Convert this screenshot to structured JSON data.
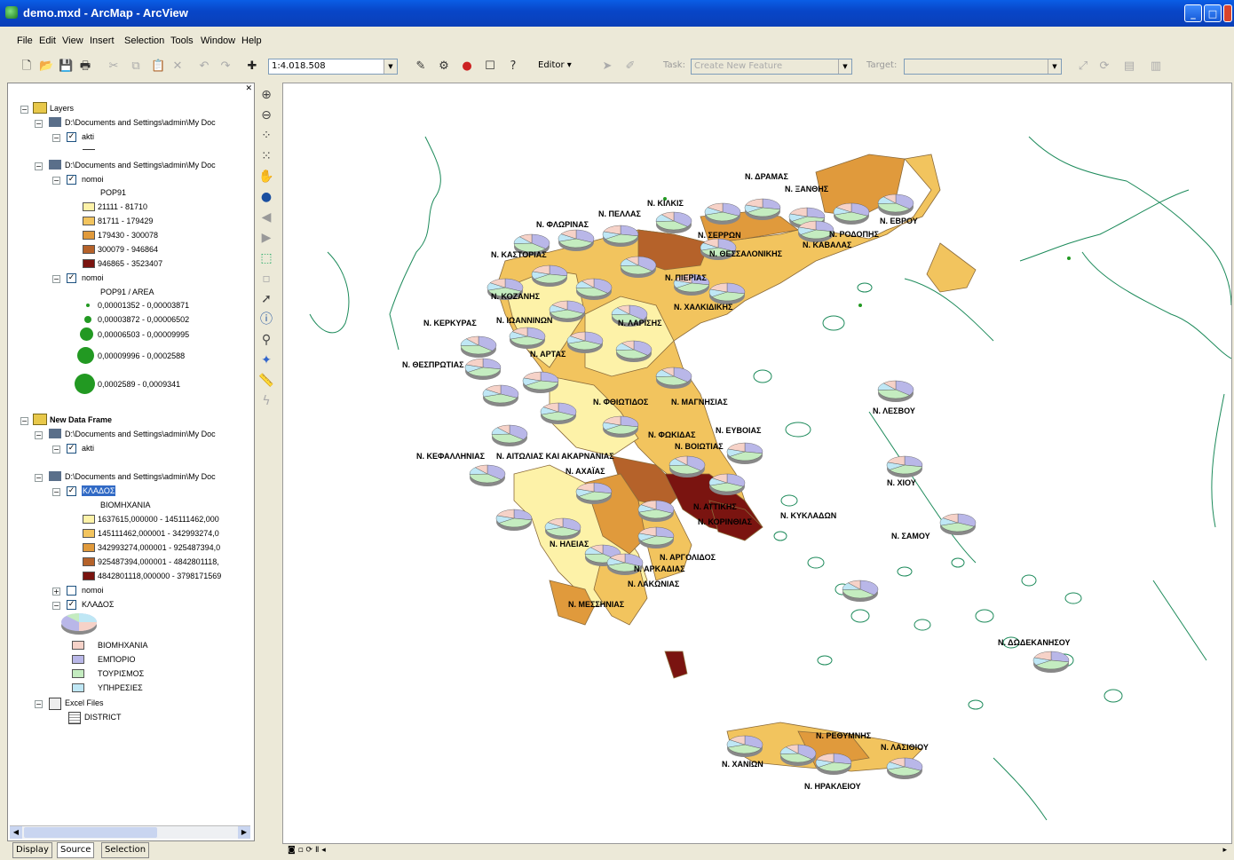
{
  "window": {
    "title": "demo.mxd - ArcMap - ArcView"
  },
  "menu": [
    "File",
    "Edit",
    "View",
    "Insert",
    "Selection",
    "Tools",
    "Window",
    "Help"
  ],
  "toolbar": {
    "scale": "1:4.018.508",
    "editor_label": "Editor",
    "task_label": "Task:",
    "task_value": "Create New Feature",
    "target_label": "Target:"
  },
  "toc": {
    "frame1": "Layers",
    "path": "D:\\Documents and Settings\\admin\\My Doc",
    "layer_akti": "akti",
    "layer_nomoi": "nomoi",
    "pop_field": "POP91",
    "pop_classes": [
      {
        "label": "21111 - 81710",
        "color": "#fdf2a8"
      },
      {
        "label": "81711 - 179429",
        "color": "#f2c45e"
      },
      {
        "label": "179430 - 300078",
        "color": "#e09a3c"
      },
      {
        "label": "300079 - 946864",
        "color": "#b5622a"
      },
      {
        "label": "946865 - 3523407",
        "color": "#7a1410"
      }
    ],
    "density_field": "POP91 / AREA",
    "density_classes": [
      {
        "label": "0,00001352 - 0,00003871"
      },
      {
        "label": "0,00003872 - 0,00006502"
      },
      {
        "label": "0,00006503 - 0,00009995"
      },
      {
        "label": "0,00009996 - 0,0002588"
      },
      {
        "label": "0,0002589 - 0,0009341"
      }
    ],
    "frame2": "New Data Frame",
    "layer_klados": "ΚΛΑΔΟΣ",
    "klados_field": "ΒΙΟΜΗΧΑΝΙΑ",
    "klados_classes": [
      {
        "label": "1637615,000000 - 145111462,000",
        "color": "#fdf2a8"
      },
      {
        "label": "145111462,000001 - 342993274,0",
        "color": "#f2c45e"
      },
      {
        "label": "342993274,000001 - 925487394,0",
        "color": "#e09a3c"
      },
      {
        "label": "925487394,000001 - 4842801118,",
        "color": "#b5622a"
      },
      {
        "label": "4842801118,000000 - 3798171569",
        "color": "#7a1410"
      }
    ],
    "pie_classes": [
      {
        "label": "ΒΙΟΜΗΧΑΝΙΑ",
        "color": "#f6d2c8"
      },
      {
        "label": "ΕΜΠΟΡΙΟ",
        "color": "#b9b7e8"
      },
      {
        "label": "ΤΟΥΡΙΣΜΟΣ",
        "color": "#c4ecc0"
      },
      {
        "label": "ΥΠΗΡΕΣΙΕΣ",
        "color": "#bfe7f5"
      }
    ],
    "excel": "Excel Files",
    "district": "DISTRICT"
  },
  "toc_tabs": [
    "Display",
    "Source",
    "Selection"
  ],
  "map": {
    "labels": [
      "Ν. ΔΡΑΜΑΣ",
      "Ν. ΞΑΝΘΗΣ",
      "Ν. ΚΙΛΚΙΣ",
      "Ν. ΠΕΛΛΑΣ",
      "Ν. ΦΛΩΡΙΝΑΣ",
      "Ν. ΣΕΡΡΩΝ",
      "Ν. ΡΟΔΟΠΗΣ",
      "Ν. ΕΒΡΟΥ",
      "Ν. ΚΑΒΑΛΑΣ",
      "Ν. ΚΑΣΤΟΡΙΑΣ",
      "Ν. ΘΕΣΣΑΛΟΝΙΚΗΣ",
      "Ν. ΠΙΕΡΙΑΣ",
      "Ν. ΚΟΖΑΝΗΣ",
      "Ν. ΧΑΛΚΙΔΙΚΗΣ",
      "Ν. ΙΩΑΝΝΙΝΩΝ",
      "Ν. ΚΕΡΚΥΡΑΣ",
      "Ν. ΛΑΡΙΣΗΣ",
      "Ν. ΑΡΤΑΣ",
      "Ν. ΘΕΣΠΡΩΤΙΑΣ",
      "Ν. ΛΕΣΒΟΥ",
      "Ν. ΦΘΙΩΤΙΔΟΣ",
      "Ν. ΜΑΓΝΗΣΙΑΣ",
      "Ν. ΕΥΒΟΙΑΣ",
      "Ν. ΦΩΚΙΔΑΣ",
      "Ν. ΒΟΙΩΤΙΑΣ",
      "Ν. ΚΕΦΑΛΛΗΝΙΑΣ",
      "Ν. ΑΙΤΩΛΙΑΣ ΚΑΙ ΑΚΑΡΝΑΝΙΑΣ",
      "Ν. ΑΧΑΪΑΣ",
      "Ν. ΧΙΟΥ",
      "Ν. ΑΤΤΙΚΗΣ",
      "Ν. ΚΟΡΙΝΘΙΑΣ",
      "Ν. ΚΥΚΛΑΔΩΝ",
      "Ν. ΣΑΜΟΥ",
      "Ν. ΗΛΕΙΑΣ",
      "Ν. ΑΡΓΟΛΙΔΟΣ",
      "Ν. ΑΡΚΑΔΙΑΣ",
      "Ν. ΛΑΚΩΝΙΑΣ",
      "Ν. ΜΕΣΣΗΝΙΑΣ",
      "Ν. ΔΩΔΕΚΑΝΗΣΟΥ",
      "Ν. ΡΕΘΥΜΝΗΣ",
      "Ν. ΛΑΣΙΘΙΟΥ",
      "Ν. ΧΑΝΙΩΝ",
      "Ν. ΗΡΑΚΛΕΙΟΥ"
    ]
  },
  "colors": {
    "title_bar": "#0a5ee6",
    "water_line": "#1c8a5a",
    "region_outline": "#8a6a3a"
  }
}
